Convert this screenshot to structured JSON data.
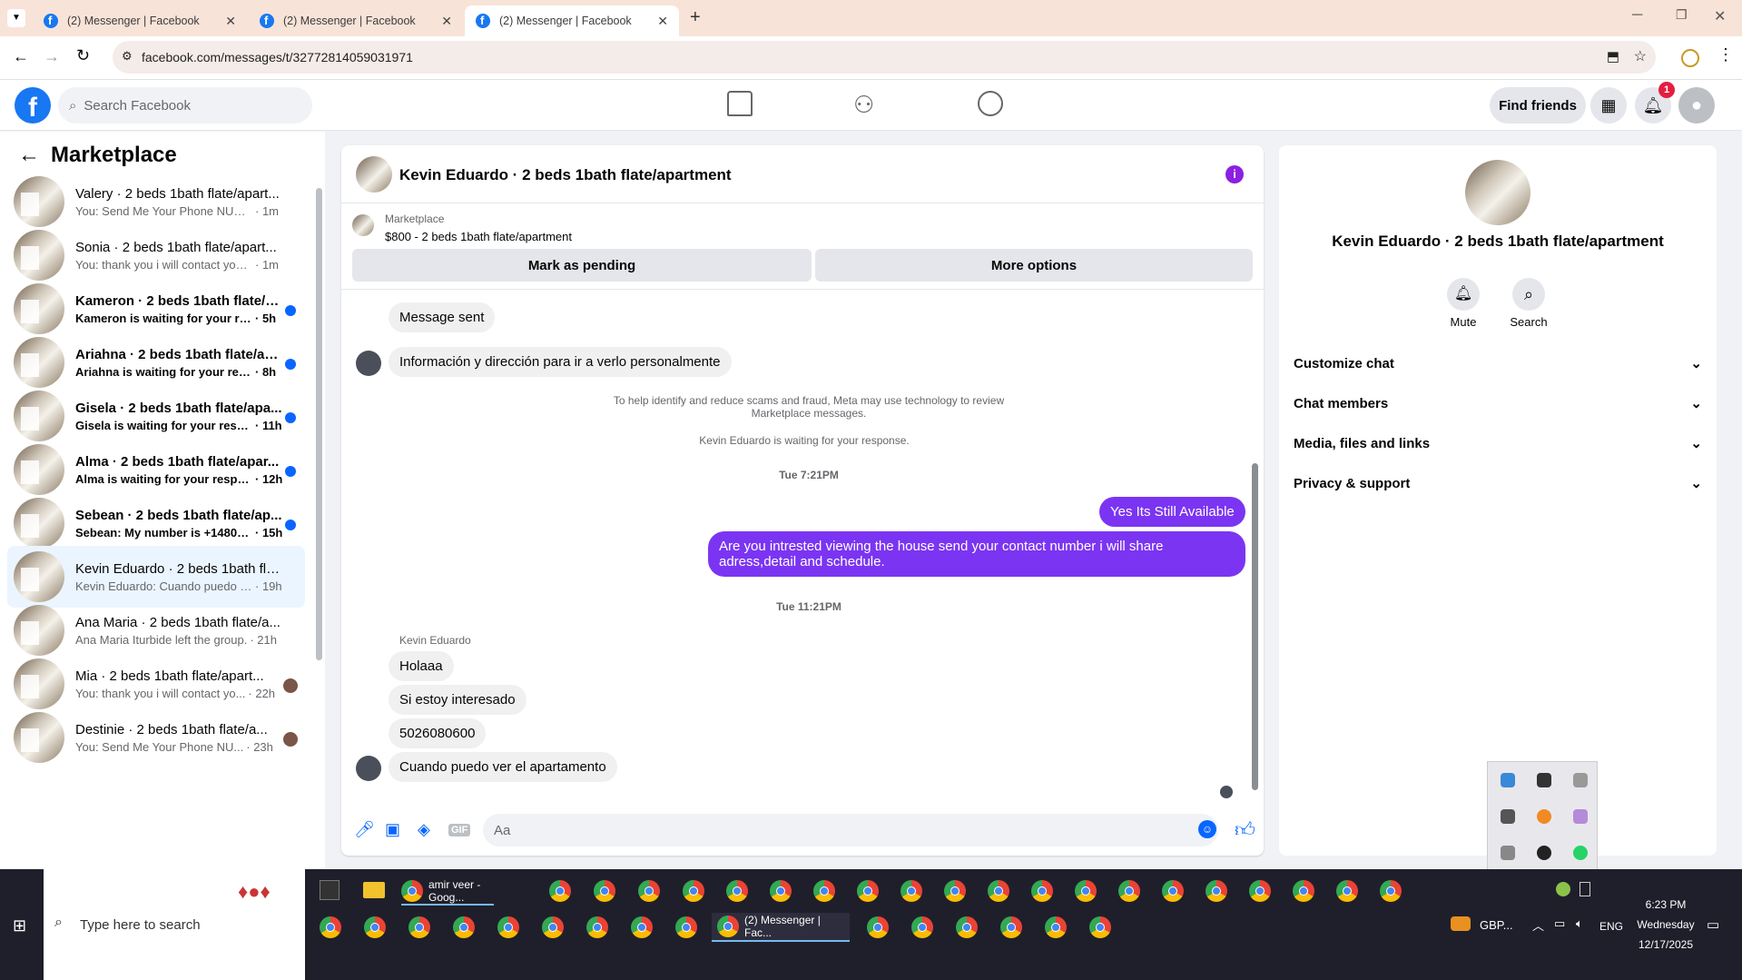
{
  "browser": {
    "tabs": [
      {
        "label": "(2) Messenger | Facebook"
      },
      {
        "label": "(2) Messenger | Facebook"
      },
      {
        "label": "(2) Messenger | Facebook"
      }
    ],
    "url": "facebook.com/messages/t/32772814059031971"
  },
  "header": {
    "search_placeholder": "Search Facebook",
    "find_friends": "Find friends",
    "notif_count": "1"
  },
  "sidebar": {
    "title": "Marketplace",
    "items": [
      {
        "title": "Valery · 2 beds 1bath flate/apart...",
        "sub": "You: Send Me Your Phone NUmbe...",
        "time": "· 1m",
        "unread": false
      },
      {
        "title": "Sonia · 2 beds 1bath flate/apart...",
        "sub": "You: thank you i will contact you v...",
        "time": "· 1m",
        "unread": false
      },
      {
        "title": "Kameron · 2 beds 1bath flate/a...",
        "sub": "Kameron is waiting for your res...",
        "time": "· 5h",
        "unread": true
      },
      {
        "title": "Ariahna · 2 beds 1bath flate/ap...",
        "sub": "Ariahna is waiting for your resp...",
        "time": "· 8h",
        "unread": true
      },
      {
        "title": "Gisela · 2 beds 1bath flate/apa...",
        "sub": "Gisela is waiting for your respo...",
        "time": "· 11h",
        "unread": true
      },
      {
        "title": "Alma · 2 beds 1bath flate/apar...",
        "sub": "Alma is waiting for your respo...",
        "time": "· 12h",
        "unread": true
      },
      {
        "title": "Sebean · 2 beds 1bath flate/ap...",
        "sub": "Sebean: My number is +14809...",
        "time": "· 15h",
        "unread": true
      },
      {
        "title": "Kevin Eduardo · 2 beds 1bath fla...",
        "sub": "Kevin Eduardo: Cuando puedo ver...",
        "time": "· 19h",
        "unread": false
      },
      {
        "title": "Ana Maria · 2 beds 1bath flate/a...",
        "sub": "Ana Maria Iturbide left the group.",
        "time": "· 21h",
        "unread": false
      },
      {
        "title": "Mia · 2 beds 1bath flate/apart...",
        "sub": "You: thank you i will contact yo...",
        "time": "· 22h",
        "unread": false
      },
      {
        "title": "Destinie · 2 beds 1bath flate/a...",
        "sub": "You: Send Me Your Phone NU...",
        "time": "· 23h",
        "unread": false
      }
    ]
  },
  "chat": {
    "title": "Kevin Eduardo · 2 beds 1bath flate/apartment",
    "listing_label": "Marketplace",
    "listing_price": "$800 - 2 beds 1bath flate/apartment",
    "mark_pending": "Mark as pending",
    "more_options": "More options",
    "messages": {
      "sent_status": "Message sent",
      "info": "Información y dirección para ir a verlo personalmente",
      "scam_notice": "To help identify and reduce scams and fraud, Meta may use technology to review Marketplace messages.",
      "waiting": "Kevin Eduardo is waiting for your response.",
      "ts1": "Tue 7:21PM",
      "me1": "Yes Its Still Available",
      "me2": "Are you intrested viewing the house send your contact number i will share adress,detail and schedule.",
      "ts2": "Tue 11:21PM",
      "sender": "Kevin Eduardo",
      "m1": "Holaaa",
      "m2": "Si estoy interesado",
      "m3": "5026080600",
      "m4": "Cuando puedo ver el apartamento"
    },
    "input_placeholder": "Aa"
  },
  "details": {
    "name": "Kevin Eduardo · 2 beds 1bath flate/apartment",
    "mute": "Mute",
    "search": "Search",
    "sections": [
      "Customize chat",
      "Chat members",
      "Media, files and links",
      "Privacy & support"
    ]
  },
  "taskbar": {
    "search": "Type here to search",
    "task1": "amir veer - Goog...",
    "task2": "(2) Messenger | Fac...",
    "weather": "GBP...",
    "lang": "ENG",
    "time": "6:23 PM",
    "day": "Wednesday",
    "date": "12/17/2025"
  },
  "colors": {
    "fb_blue": "#1877f2",
    "accent_purple": "#7b35f2",
    "unread_dot": "#0866ff"
  }
}
